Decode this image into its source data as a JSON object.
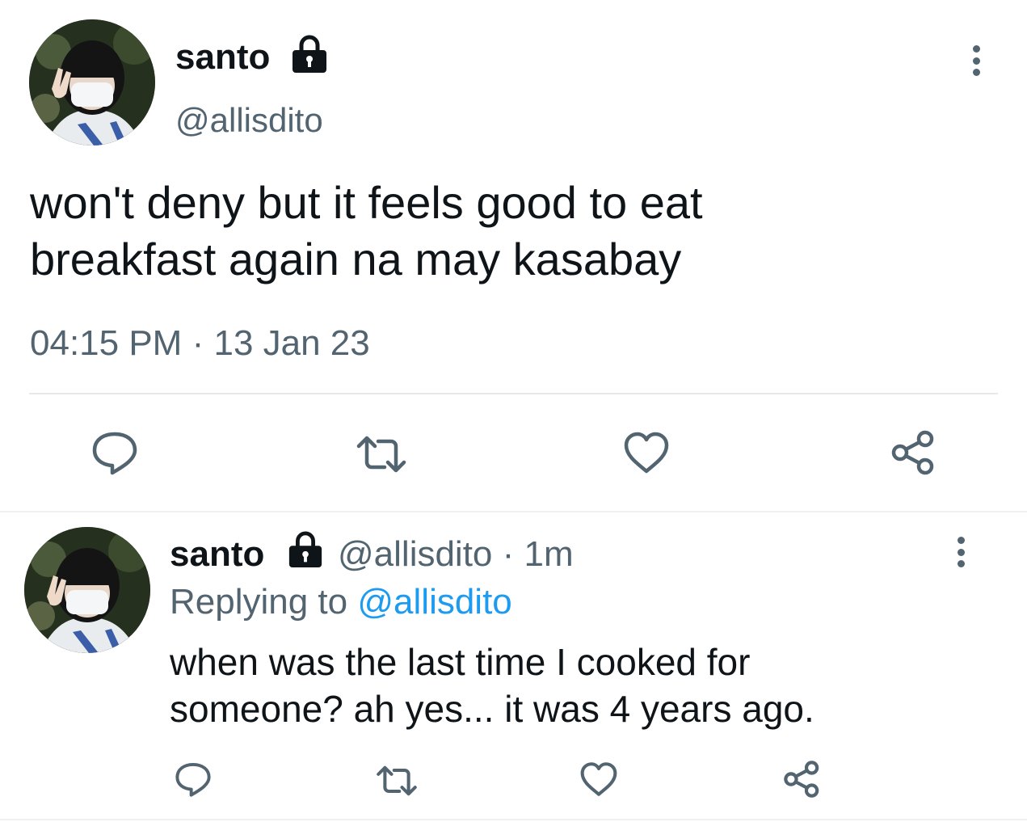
{
  "main_tweet": {
    "display_name": "santo",
    "handle": "@allisdito",
    "text_line1": "won't deny but it feels good to eat",
    "text_line2": "breakfast again na may kasabay",
    "time": "04:15 PM",
    "separator": "·",
    "date": "13 Jan 23",
    "actions": [
      "reply-icon",
      "retweet-icon",
      "like-icon",
      "share-icon"
    ]
  },
  "reply_tweet": {
    "display_name": "santo",
    "handle": "@allisdito",
    "separator": "·",
    "age": "1m",
    "replying_prefix": "Replying to",
    "replying_handle": "@allisdito",
    "text_line1": "when was the last time I cooked for",
    "text_line2": "someone? ah yes... it was 4 years ago.",
    "actions": [
      "reply-icon",
      "retweet-icon",
      "like-icon",
      "share-icon"
    ]
  },
  "colors": {
    "text": "#0f1419",
    "muted": "#536471",
    "link": "#1d9bf0",
    "divider": "#e6e9ec"
  }
}
